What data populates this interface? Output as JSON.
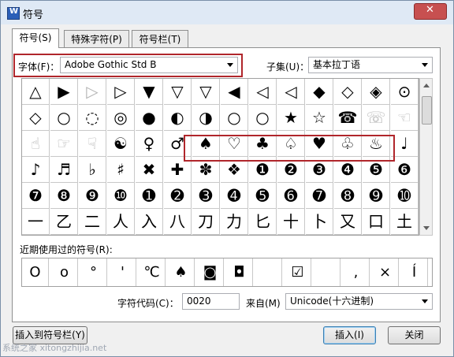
{
  "window": {
    "title": "符号",
    "app_icon_letter": "W"
  },
  "tabs": [
    {
      "label": "符号(S)",
      "active": true
    },
    {
      "label": "特殊字符(P)",
      "active": false
    },
    {
      "label": "符号栏(T)",
      "active": false
    }
  ],
  "font": {
    "label": "字体(F)：",
    "value": "Adobe Gothic Std B"
  },
  "subset": {
    "label": "子集(U)：",
    "value": "基本拉丁语"
  },
  "symbol_grid": [
    [
      "△",
      "▶",
      "▷",
      "▷",
      "▼",
      "▽",
      "▽",
      "◀",
      "◁",
      "◁",
      "◆",
      "◇",
      "◈",
      "⊙"
    ],
    [
      "◇",
      "○",
      "◌",
      "◎",
      "●",
      "◐",
      "◑",
      "○",
      "○",
      "★",
      "☆",
      "☎",
      "☏",
      "☜"
    ],
    [
      "☝",
      "☞",
      "☟",
      "☯",
      "♀",
      "♂",
      "♠",
      "♡",
      "♣",
      "♤",
      "♥",
      "♧",
      "♨",
      "♩"
    ],
    [
      "♪",
      "♬",
      "♭",
      "♯",
      "✖",
      "✚",
      "✽",
      "❖",
      "❶",
      "❷",
      "❸",
      "❹",
      "❺",
      "❻"
    ],
    [
      "❼",
      "❽",
      "❾",
      "❿",
      "➊",
      "➋",
      "➌",
      "➍",
      "➎",
      "➏",
      "➐",
      "➑",
      "➒",
      "➓"
    ],
    [
      "一",
      "乙",
      "二",
      "人",
      "入",
      "八",
      "刀",
      "力",
      "匕",
      "十",
      "卜",
      "又",
      "口",
      "土"
    ]
  ],
  "recent": {
    "label": "近期使用过的符号(R):",
    "items": [
      "O",
      "o",
      "°",
      "'",
      "℃",
      "♠",
      "◙",
      "◘",
      "",
      "☑",
      "",
      ",",
      "×",
      "Í"
    ]
  },
  "char_code": {
    "label": "字符代码(C)：",
    "value": "0020"
  },
  "from": {
    "label": "来自(M)",
    "value": "Unicode(十六进制)"
  },
  "buttons": {
    "insert_to_bar": "插入到符号栏(Y)",
    "insert": "插入(I)",
    "close": "关闭"
  },
  "close_glyph": "✕",
  "watermark": "系统之家 xitongzhijia.net"
}
